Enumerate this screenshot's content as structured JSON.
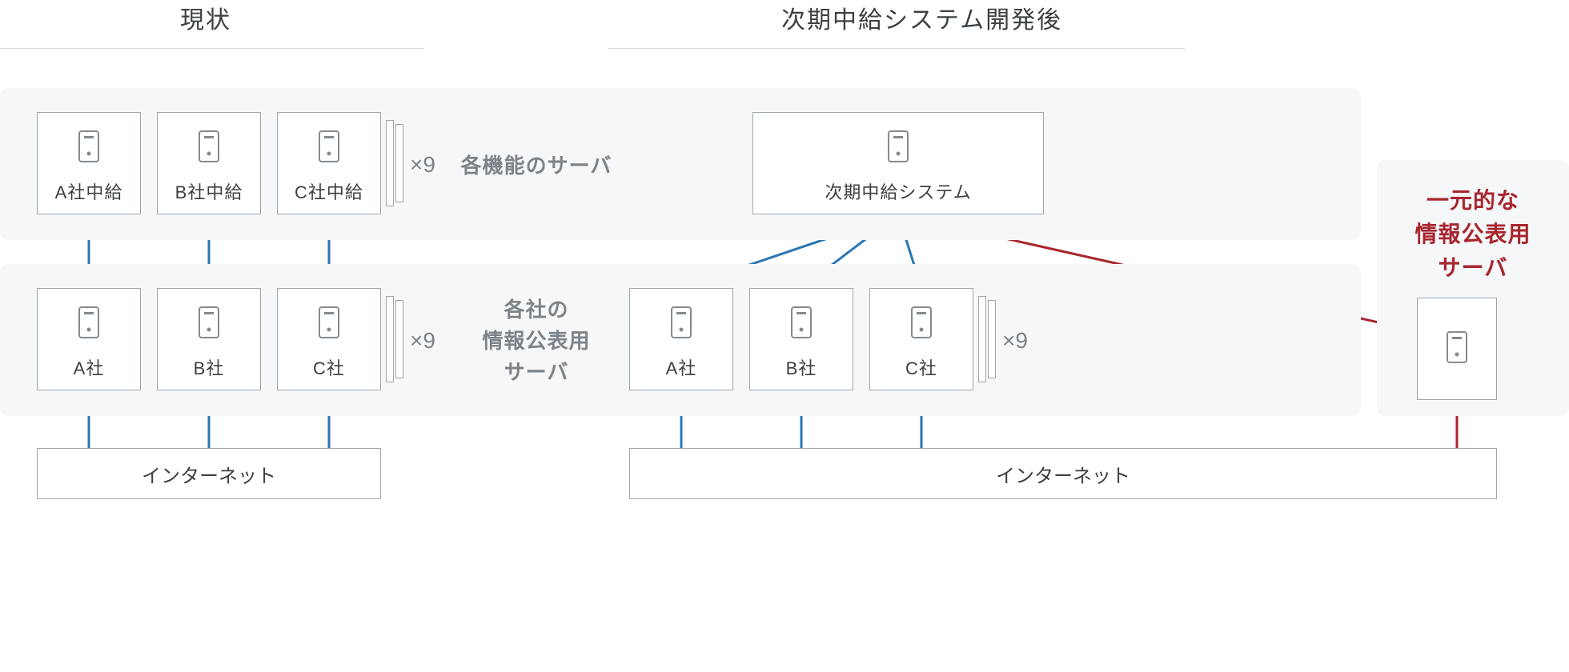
{
  "headings": {
    "left": "現状",
    "right": "次期中給システム開発後"
  },
  "row_labels": {
    "top": "各機能のサーバ",
    "bottom": "各社の\n情報公表用\nサーバ"
  },
  "multiplier": "×9",
  "left": {
    "top_boxes": [
      "A社中給",
      "B社中給",
      "C社中給"
    ],
    "bottom_boxes": [
      "A社",
      "B社",
      "C社"
    ],
    "internet": "インターネット"
  },
  "right": {
    "top_box": "次期中給システム",
    "bottom_boxes": [
      "A社",
      "B社",
      "C社"
    ],
    "unified_label": "一元的な\n情報公表用\nサーバ",
    "internet": "インターネット"
  },
  "colors": {
    "blue": "#2b77b3",
    "red": "#a8262e"
  }
}
